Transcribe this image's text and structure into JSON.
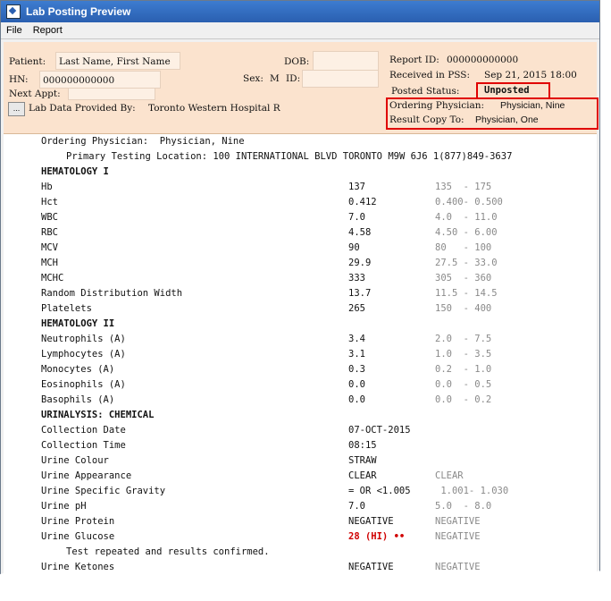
{
  "window": {
    "title": "Lab Posting Preview"
  },
  "menu": [
    "File",
    "Report"
  ],
  "header": {
    "patient_label": "Patient:",
    "patient_value": "Last Name, First Name",
    "dob_label": "DOB:",
    "hn_label": "HN:",
    "hn_value": "000000000000",
    "sex_label": "Sex:",
    "sex_value": "M",
    "id_label": "ID:",
    "next_appt_label": "Next Appt:",
    "ellipsis_label": "...",
    "provided_by_label": "Lab Data Provided By:",
    "provided_by_value": "Toronto Western Hospital R",
    "report_id_label": "Report ID:",
    "report_id_value": "000000000000",
    "received_label": "Received in PSS:",
    "received_value": "Sep 21, 2015 18:00",
    "posted_status_label": "Posted Status:",
    "posted_status_value": "Unposted",
    "ordering_physician_label": "Ordering Physician:",
    "ordering_physician_value": "Physician, Nine",
    "result_copy_label": "Result Copy To:",
    "result_copy_value": "Physician, One"
  },
  "report": {
    "ordering_line": "Ordering Physician:  Physician, Nine",
    "location_line": "Primary Testing Location: 100 INTERNATIONAL BLVD TORONTO M9W 6J6 1(877)849-3637",
    "rows": [
      {
        "type": "section",
        "name": "HEMATOLOGY I"
      },
      {
        "name": "Hb",
        "value": "137",
        "ref": "135  - 175"
      },
      {
        "name": "Hct",
        "value": "0.412",
        "ref": "0.400- 0.500"
      },
      {
        "name": "WBC",
        "value": "7.0",
        "ref": "4.0  - 11.0"
      },
      {
        "name": "RBC",
        "value": "4.58",
        "ref": "4.50 - 6.00"
      },
      {
        "name": "MCV",
        "value": "90",
        "ref": "80   - 100"
      },
      {
        "name": "MCH",
        "value": "29.9",
        "ref": "27.5 - 33.0"
      },
      {
        "name": "MCHC",
        "value": "333",
        "ref": "305  - 360"
      },
      {
        "name": "Random Distribution Width",
        "value": "13.7",
        "ref": "11.5 - 14.5"
      },
      {
        "name": "Platelets",
        "value": "265",
        "ref": "150  - 400"
      },
      {
        "type": "section",
        "name": "HEMATOLOGY II"
      },
      {
        "name": "Neutrophils (A)",
        "value": "3.4",
        "ref": "2.0  - 7.5"
      },
      {
        "name": "Lymphocytes (A)",
        "value": "3.1",
        "ref": "1.0  - 3.5"
      },
      {
        "name": "Monocytes (A)",
        "value": "0.3",
        "ref": "0.2  - 1.0"
      },
      {
        "name": "Eosinophils (A)",
        "value": "0.0",
        "ref": "0.0  - 0.5"
      },
      {
        "name": "Basophils (A)",
        "value": "0.0",
        "ref": "0.0  - 0.2"
      },
      {
        "type": "section",
        "name": "URINALYSIS: CHEMICAL"
      },
      {
        "name": "Collection Date",
        "value": "07-OCT-2015",
        "ref": ""
      },
      {
        "name": "Collection Time",
        "value": "08:15",
        "ref": ""
      },
      {
        "name": "Urine Colour",
        "value": "STRAW",
        "ref": ""
      },
      {
        "name": "Urine Appearance",
        "value": "CLEAR",
        "ref": "CLEAR"
      },
      {
        "name": "Urine Specific Gravity",
        "value": "= OR <1.005",
        "ref": " 1.001- 1.030"
      },
      {
        "name": "Urine pH",
        "value": "7.0",
        "ref": "5.0  - 8.0"
      },
      {
        "name": "Urine Protein",
        "value": "NEGATIVE",
        "ref": "NEGATIVE"
      },
      {
        "name": "Urine Glucose",
        "value": "28 (HI) ••",
        "ref": "NEGATIVE",
        "abnormal": true
      },
      {
        "type": "note",
        "name": "Test repeated and results confirmed."
      },
      {
        "name": "Urine Ketones",
        "value": "NEGATIVE",
        "ref": "NEGATIVE"
      }
    ]
  }
}
